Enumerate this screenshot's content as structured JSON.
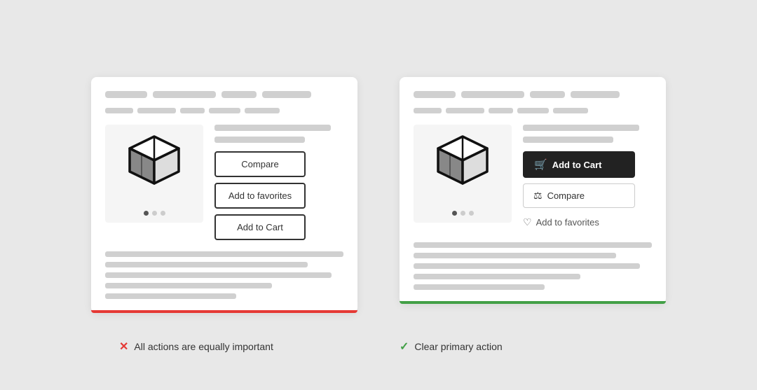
{
  "bad_card": {
    "header_lines": [
      60,
      90,
      50,
      70
    ],
    "nav_lines": [
      40,
      55,
      35,
      45,
      50
    ],
    "product_image_alt": "Box product icon",
    "buttons": [
      "Compare",
      "Add to favorites",
      "Add to Cart"
    ],
    "desc_lines": [
      100,
      85,
      95,
      70,
      55
    ],
    "caption_icon": "✕",
    "caption_text": "All actions are equally important"
  },
  "good_card": {
    "header_lines": [
      60,
      90,
      50,
      70
    ],
    "nav_lines": [
      40,
      55,
      35,
      45,
      50
    ],
    "product_image_alt": "Box product icon",
    "primary_button": "Add to Cart",
    "secondary_button": "Compare",
    "text_button": "Add to favorites",
    "desc_lines": [
      100,
      85,
      95,
      70,
      55
    ],
    "caption_icon": "✓",
    "caption_text": "Clear primary action"
  }
}
